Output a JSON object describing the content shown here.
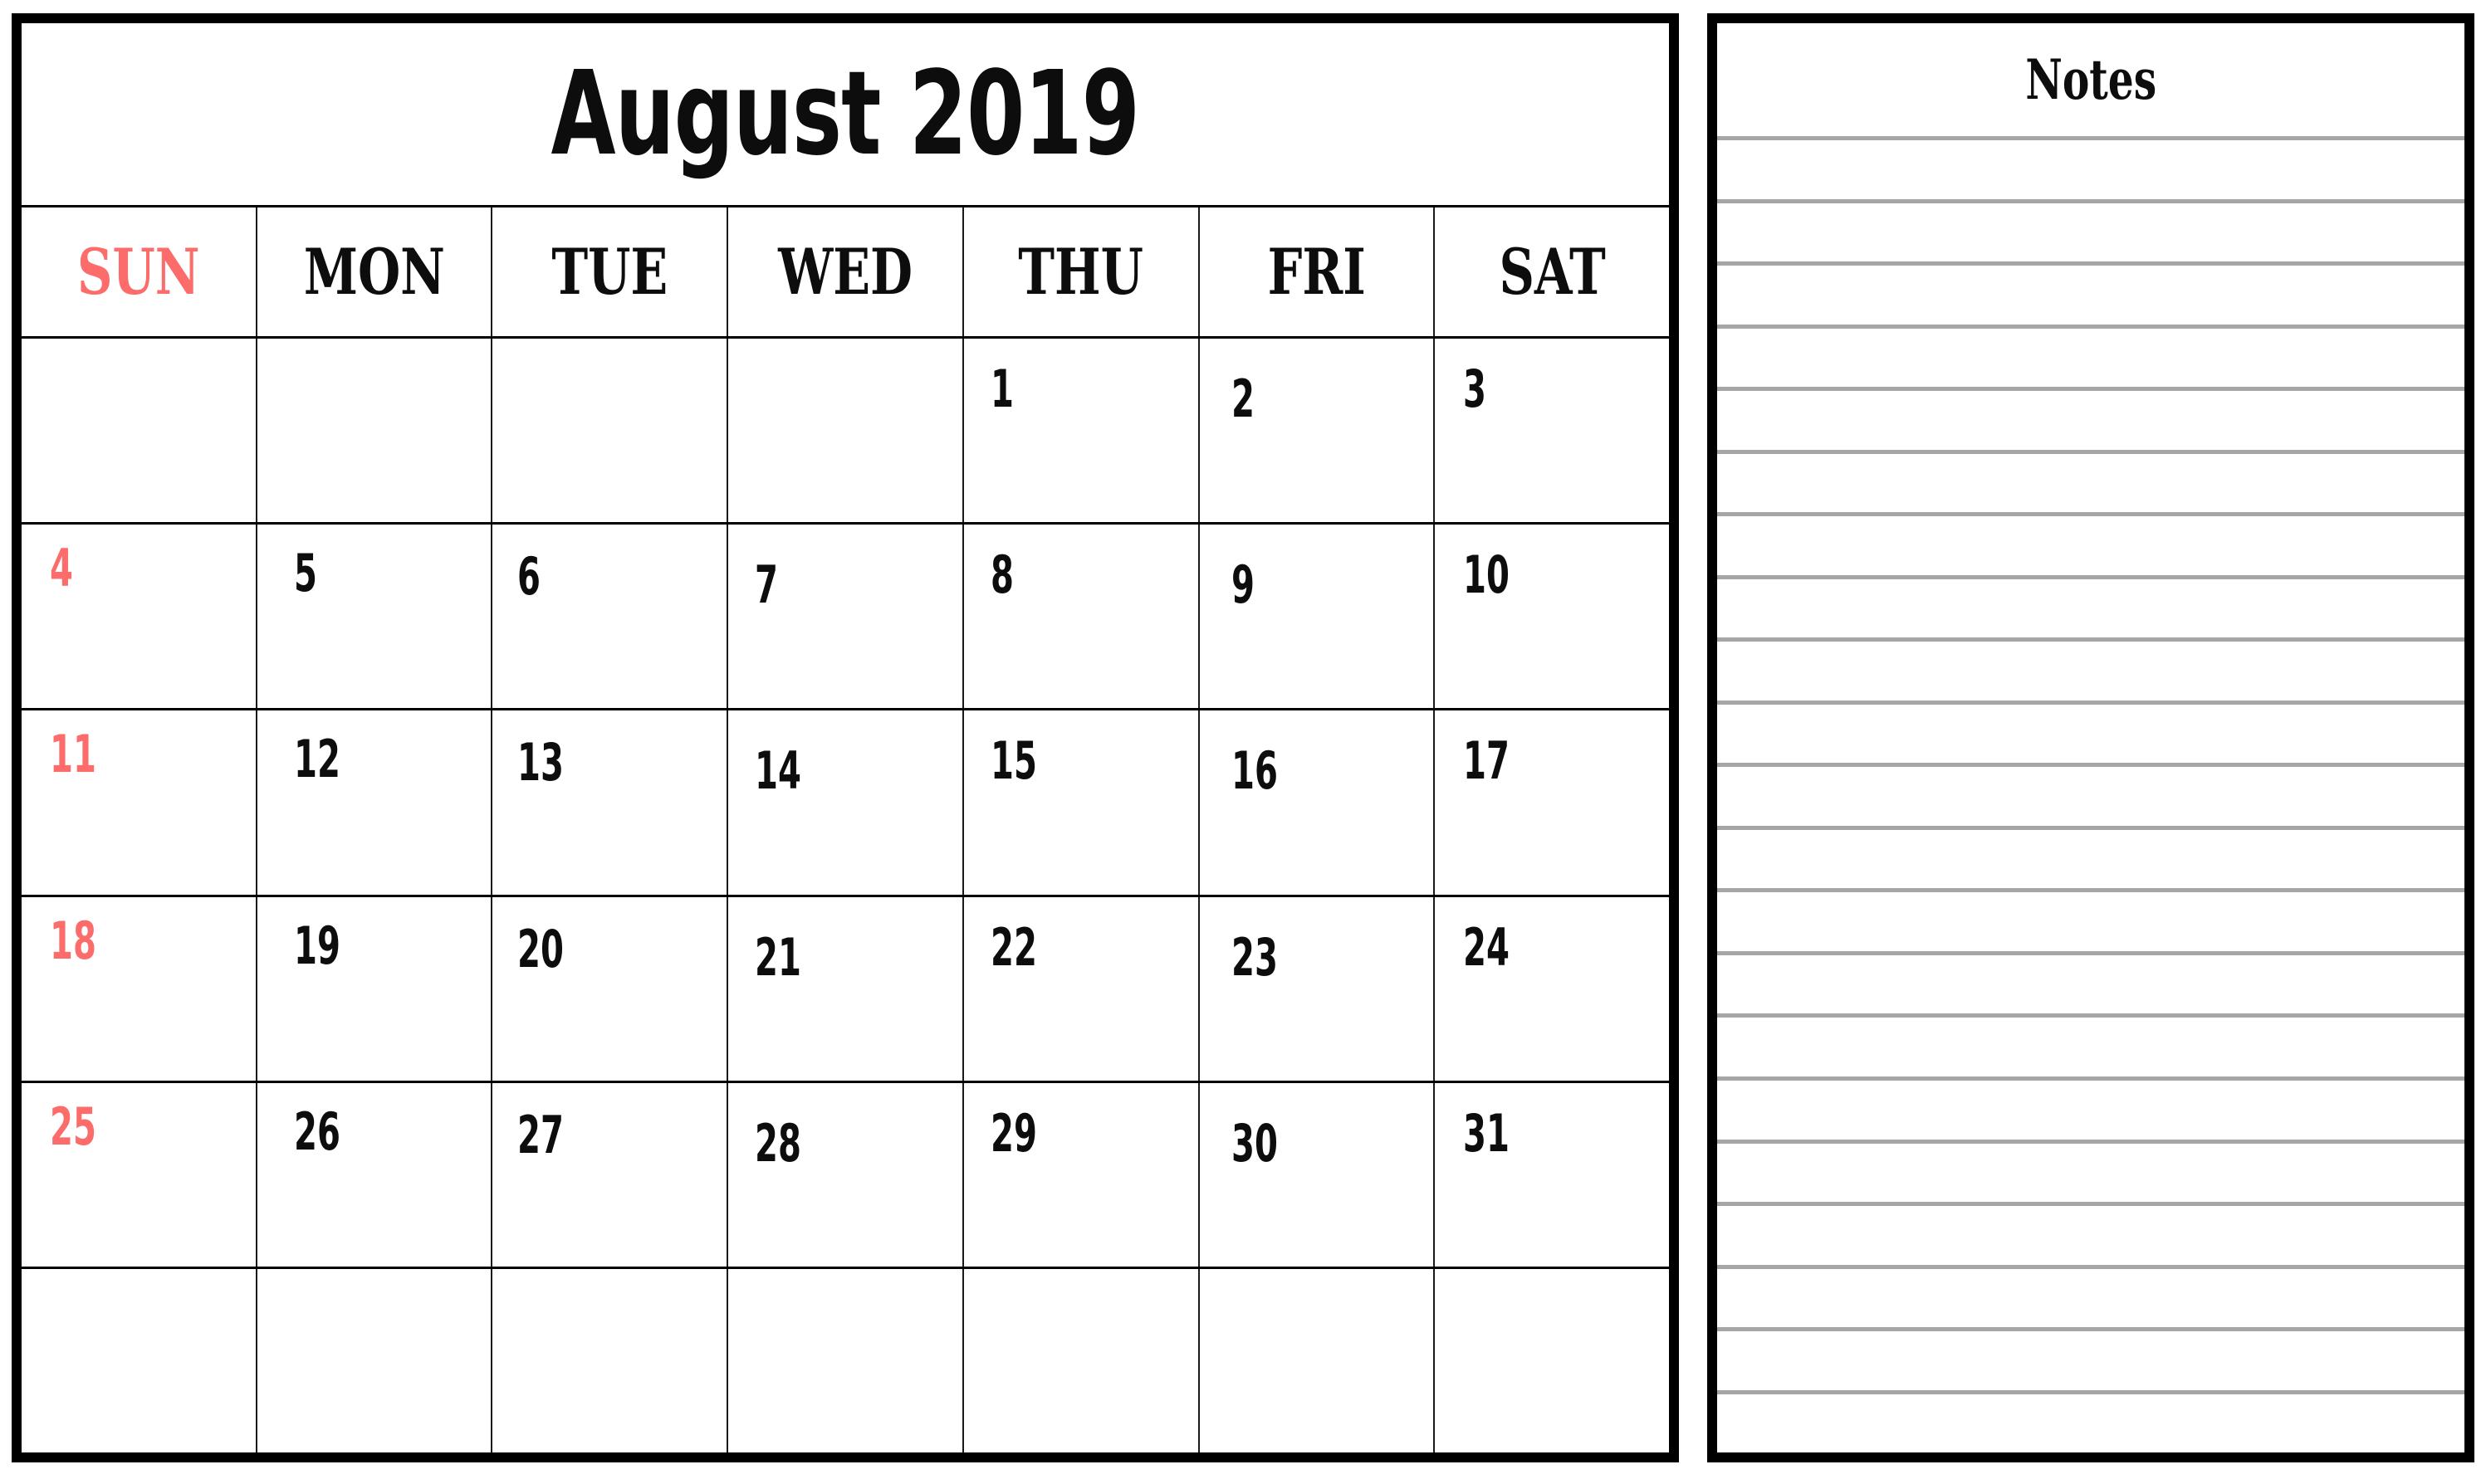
{
  "calendar": {
    "title": "August 2019",
    "month": "August",
    "year": "2019",
    "weekday_headers": [
      {
        "label": "SUN",
        "highlight": true
      },
      {
        "label": "MON",
        "highlight": false
      },
      {
        "label": "TUE",
        "highlight": false
      },
      {
        "label": "WED",
        "highlight": false
      },
      {
        "label": "THU",
        "highlight": false
      },
      {
        "label": "FRI",
        "highlight": false
      },
      {
        "label": "SAT",
        "highlight": false
      }
    ],
    "weeks": [
      [
        "",
        "",
        "",
        "",
        "1",
        "2",
        "3"
      ],
      [
        "4",
        "5",
        "6",
        "7",
        "8",
        "9",
        "10"
      ],
      [
        "11",
        "12",
        "13",
        "14",
        "15",
        "16",
        "17"
      ],
      [
        "18",
        "19",
        "20",
        "21",
        "22",
        "23",
        "24"
      ],
      [
        "25",
        "26",
        "27",
        "28",
        "29",
        "30",
        "31"
      ],
      [
        "",
        "",
        "",
        "",
        "",
        "",
        ""
      ]
    ],
    "sunday_color": "#fb6c6a",
    "text_color": "#0d0d0d",
    "border_color": "#000000"
  },
  "notes": {
    "title": "Notes",
    "line_count": 21,
    "line_color": "#a6a6a6"
  }
}
